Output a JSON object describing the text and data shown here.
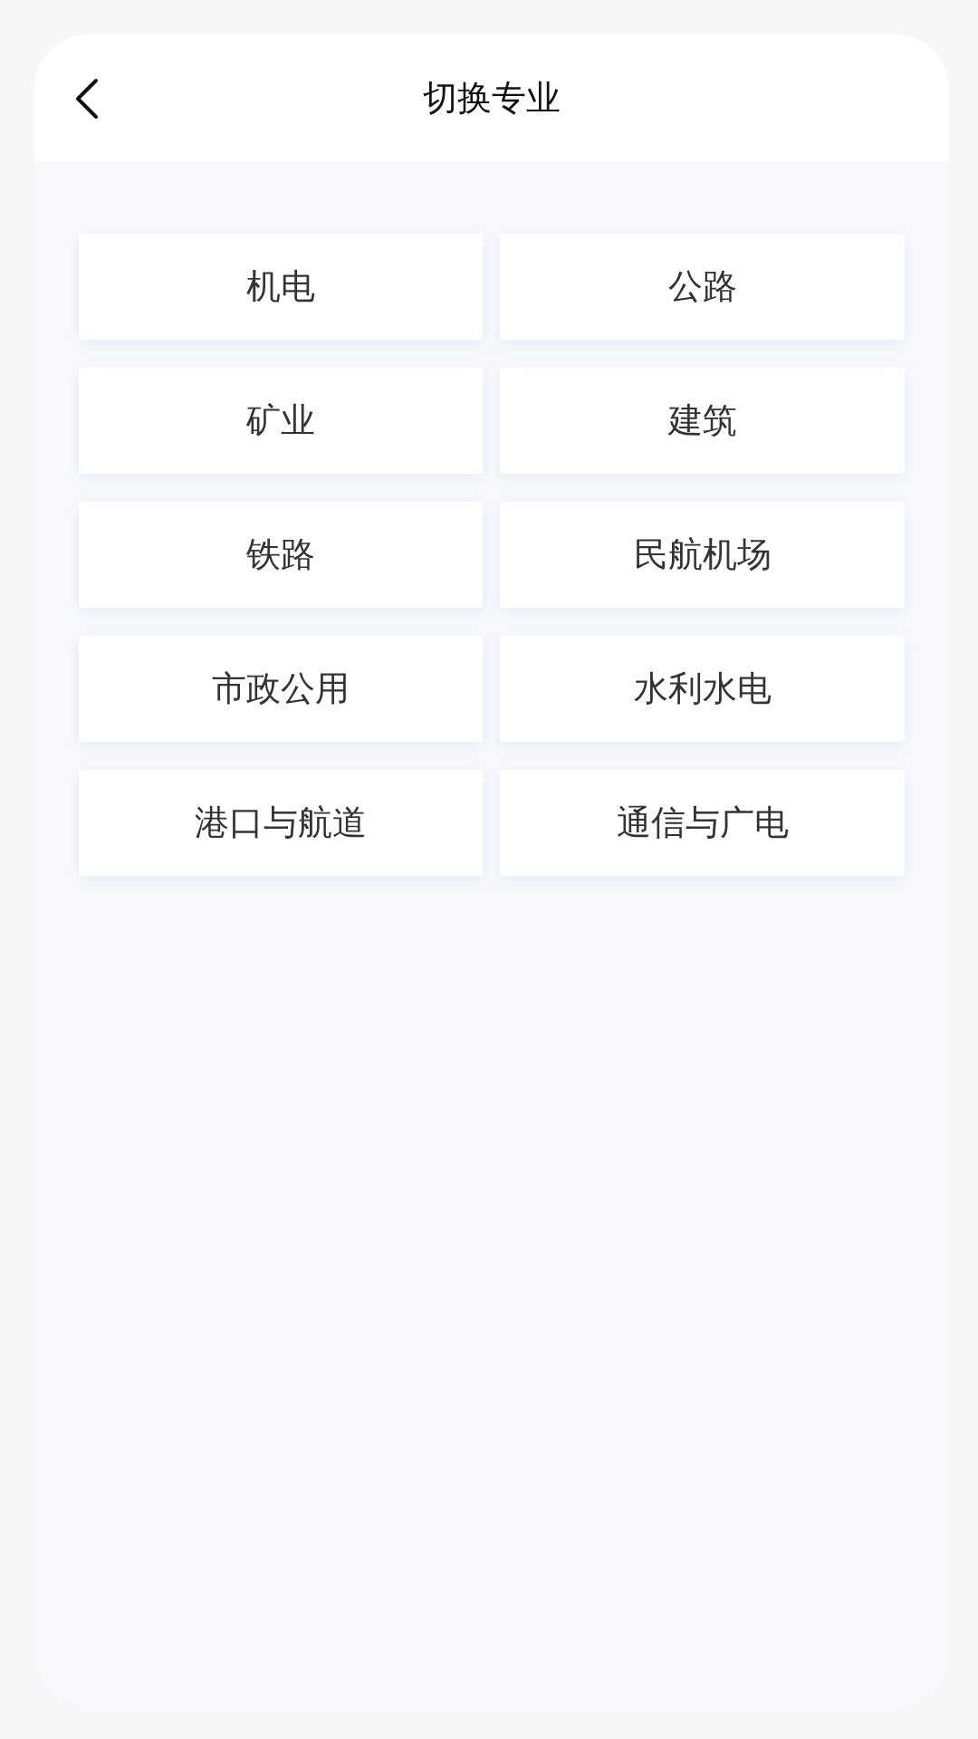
{
  "header": {
    "title": "切换专业"
  },
  "majors": [
    {
      "label": "机电"
    },
    {
      "label": "公路"
    },
    {
      "label": "矿业"
    },
    {
      "label": "建筑"
    },
    {
      "label": "铁路"
    },
    {
      "label": "民航机场"
    },
    {
      "label": "市政公用"
    },
    {
      "label": "水利水电"
    },
    {
      "label": "港口与航道"
    },
    {
      "label": "通信与广电"
    }
  ]
}
